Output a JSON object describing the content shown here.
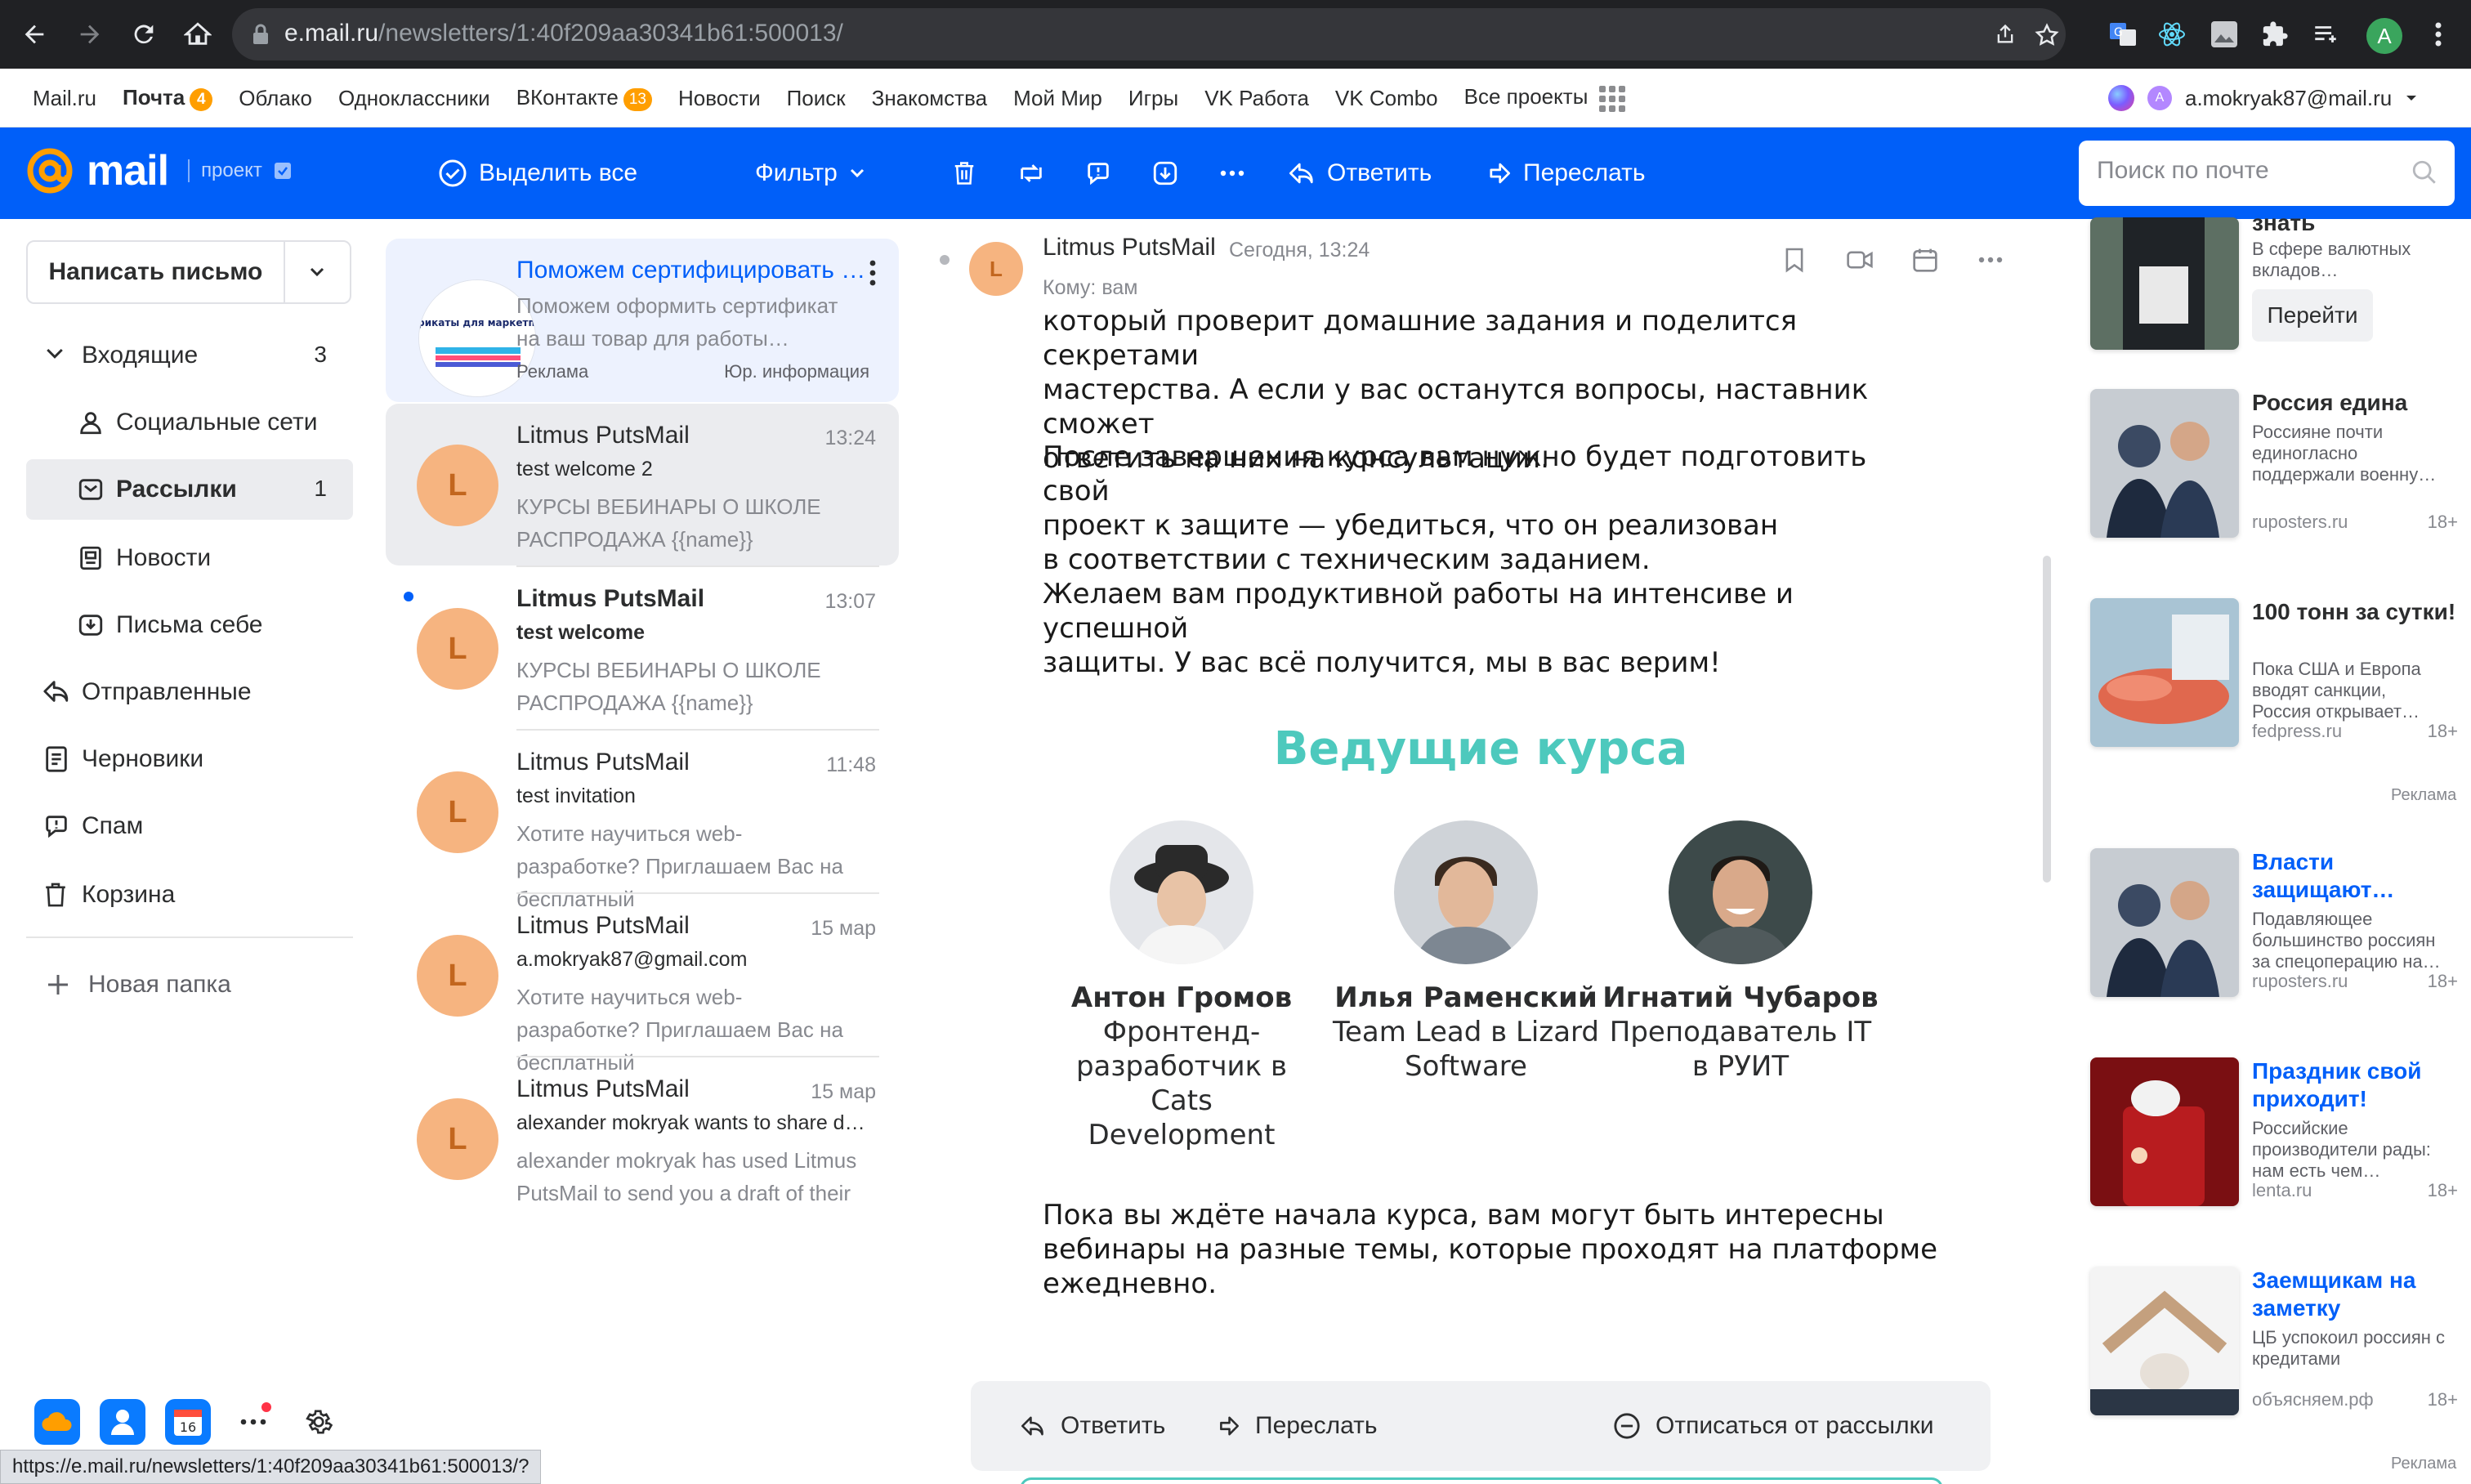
{
  "browser": {
    "url_host": "e.mail.ru",
    "url_path": "/newsletters/1:40f209aa30341b61:500013/",
    "profile_initial": "A",
    "status_url": "https://e.mail.ru/newsletters/1:40f209aa30341b61:500013/?"
  },
  "portal": {
    "links": [
      {
        "label": "Mail.ru"
      },
      {
        "label": "Почта",
        "badge": "4",
        "bold": true
      },
      {
        "label": "Облако"
      },
      {
        "label": "Одноклассники"
      },
      {
        "label": "ВКонтакте",
        "badge": "13"
      },
      {
        "label": "Новости"
      },
      {
        "label": "Поиск"
      },
      {
        "label": "Знакомства"
      },
      {
        "label": "Мой Мир"
      },
      {
        "label": "Игры"
      },
      {
        "label": "VK Работа"
      },
      {
        "label": "VK Combo"
      },
      {
        "label": "Все проекты"
      }
    ],
    "user_email": "a.mokryak87@mail.ru",
    "user_initial": "A"
  },
  "toolbar": {
    "logo": "mail",
    "project": "проект",
    "select_all": "Выделить все",
    "filter": "Фильтр",
    "reply": "Ответить",
    "forward": "Переслать",
    "search_placeholder": "Поиск по почте",
    "accent": "#005ff9"
  },
  "sidebar": {
    "compose": "Написать письмо",
    "folders": [
      {
        "label": "Входящие",
        "count": "3"
      },
      {
        "label": "Социальные сети",
        "count": ""
      },
      {
        "label": "Рассылки",
        "count": "1"
      },
      {
        "label": "Новости",
        "count": ""
      },
      {
        "label": "Письма себе",
        "count": ""
      },
      {
        "label": "Отправленные",
        "count": ""
      },
      {
        "label": "Черновики",
        "count": ""
      },
      {
        "label": "Спам",
        "count": ""
      },
      {
        "label": "Корзина",
        "count": ""
      }
    ],
    "new_folder": "Новая папка",
    "calendar_day": "16"
  },
  "list": {
    "ad": {
      "title": "Поможем сертифицировать товар",
      "snippet": "Поможем оформить сертификат на ваш товар для работы…",
      "label": "Реклама",
      "legal": "Юр. информация",
      "image_text": "Сертификаты для маркетплейсов"
    },
    "messages": [
      {
        "initial": "L",
        "from": "Litmus PutsMail",
        "time": "13:24",
        "subject": "test welcome 2",
        "snippet": "КУРСЫ ВЕБИНАРЫ О ШКОЛЕ РАСПРОДАЖА {{name}}",
        "unread": false
      },
      {
        "initial": "L",
        "from": "Litmus PutsMail",
        "time": "13:07",
        "subject": "test welcome",
        "snippet": "КУРСЫ ВЕБИНАРЫ О ШКОЛЕ РАСПРОДАЖА {{name}}",
        "unread": true
      },
      {
        "initial": "L",
        "from": "Litmus PutsMail",
        "time": "11:48",
        "subject": "test invitation",
        "snippet": "Хотите научиться web-разработке? Приглашаем Вас на бесплатный",
        "unread": false
      },
      {
        "initial": "L",
        "from": "Litmus PutsMail",
        "time": "15 мар",
        "subject": "a.mokryak87@gmail.com",
        "snippet": "Хотите научиться web-разработке? Приглашаем Вас на бесплатный",
        "unread": false
      },
      {
        "initial": "L",
        "from": "Litmus PutsMail",
        "time": "15 мар",
        "subject": "alexander mokryak wants to share d…",
        "snippet": "alexander mokryak has used Litmus PutsMail to send you a draft of their",
        "unread": false
      }
    ]
  },
  "reader": {
    "initial": "L",
    "sender": "Litmus PutsMail",
    "date": "Сегодня, 13:24",
    "to": "Кому:  вам",
    "paragraphs": [
      "который проверит домашние задания и поделится секретами\nмастерства. А если у вас останутся вопросы, наставник сможет\nответить на них на консультации.",
      "После завершения курса вам нужно будет подготовить свой\nпроект к защите — убедиться, что он реализован\nв соответствии с техническим заданием.",
      "Желаем вам продуктивной работы на интенсиве и успешной\nзащиты. У вас всё получится, мы в вас верим!"
    ],
    "heading": "Ведущие курса",
    "mentors": [
      {
        "name": "Антон Громов",
        "role": "Фронтенд-\nразработчик в Cats\nDevelopment"
      },
      {
        "name": "Илья Раменский",
        "role": "Team Lead в Lizard\nSoftware"
      },
      {
        "name": "Игнатий Чубаров",
        "role": "Преподаватель IT\nв РУИТ"
      }
    ],
    "closing": "Пока вы ждёте начала курса, вам могут быть интересны\nвебинары на разные темы, которые проходят на платформе\nежедневно.",
    "bar": {
      "reply": "Ответить",
      "forward": "Переслать",
      "unsubscribe": "Отписаться от рассылки"
    },
    "heading_color": "#4dc9bd"
  },
  "ads": {
    "top": {
      "title": "знать",
      "text": "В сфере валютных вкладов…",
      "button": "Перейти"
    },
    "cards": [
      {
        "title": "Россия едина",
        "text": "Россияне почти единогласно поддержали военну…",
        "source": "ruposters.ru",
        "age": "18+",
        "blue": false
      },
      {
        "title": "100 тонн за сутки!",
        "text": "Пока США и Европа вводят санкции, Россия открывает…",
        "source": "fedpress.ru",
        "age": "18+",
        "blue": false
      },
      {
        "title": "Власти защищают…",
        "text": "Подавляющее большинство россиян за спецоперацию на…",
        "source": "ruposters.ru",
        "age": "18+",
        "blue": true
      },
      {
        "title": "Праздник свой приходит!",
        "text": "Российские производители рады: нам есть чем…",
        "source": "lenta.ru",
        "age": "18+",
        "blue": true
      },
      {
        "title": "Заемщикам на заметку",
        "text": "ЦБ успокоил россиян с кредитами",
        "source": "объясняем.рф",
        "age": "18+",
        "blue": true
      }
    ],
    "label": "Реклама"
  }
}
